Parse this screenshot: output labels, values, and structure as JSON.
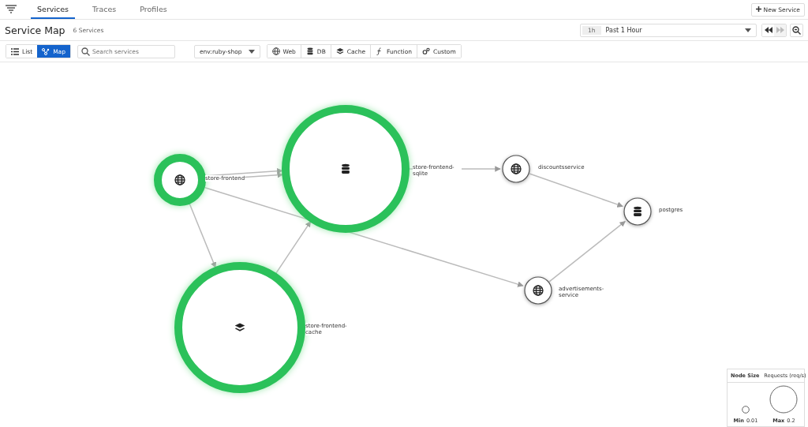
{
  "tabs": [
    {
      "label": "Services",
      "selected": true
    },
    {
      "label": "Traces",
      "selected": false
    },
    {
      "label": "Profiles",
      "selected": false
    }
  ],
  "new_button": "New Service",
  "title": "Service Map",
  "count": "6 Services",
  "time": {
    "badge": "1h",
    "label": "Past 1 Hour"
  },
  "views": [
    {
      "label": "List",
      "selected": false
    },
    {
      "label": "Map",
      "selected": true
    }
  ],
  "search": {
    "placeholder": "Search services"
  },
  "env": "env:ruby-shop",
  "filters": [
    {
      "kind": "web",
      "label": "Web"
    },
    {
      "kind": "db",
      "label": "DB"
    },
    {
      "kind": "cache",
      "label": "Cache"
    },
    {
      "kind": "function",
      "label": "Function"
    },
    {
      "kind": "custom",
      "label": "Custom"
    }
  ],
  "nodes": [
    {
      "name": "store-frontend",
      "kind": "web",
      "active": true
    },
    {
      "name": "store-frontend-sqlite",
      "kind": "db",
      "active": true
    },
    {
      "name": "store-frontend-cache",
      "kind": "cache",
      "active": true
    },
    {
      "name": "discountsservice",
      "kind": "web",
      "active": false
    },
    {
      "name": "postgres",
      "kind": "db",
      "active": false
    },
    {
      "name": "advertisements-service",
      "kind": "web",
      "active": false
    }
  ],
  "legend": {
    "title": "Node Size",
    "metric": "Requests (req/s)",
    "min_label": "Min",
    "min": "0.01",
    "max_label": "Max",
    "max": "0.2"
  }
}
